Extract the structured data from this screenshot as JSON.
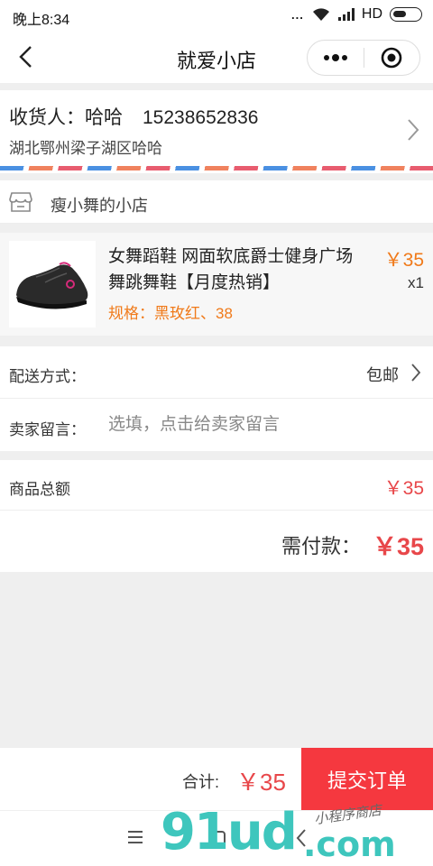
{
  "status_bar": {
    "time": "晚上8:34",
    "dots": "...",
    "network": "HD"
  },
  "nav": {
    "title": "就爱小店",
    "icons": [
      "back-arrow-icon",
      "more-dots-icon",
      "close-circle-icon"
    ]
  },
  "address": {
    "recipient": "收货人：哈哈",
    "phone": "15238652836",
    "detail": "湖北鄂州梁子湖区哈哈"
  },
  "store": {
    "name": "瘦小舞的小店",
    "icon": "store-icon"
  },
  "product": {
    "title": "女舞蹈鞋 网面软底爵士健身广场舞跳舞鞋【月度热销】",
    "spec": "规格：黑玫红、38",
    "price": "￥35",
    "quantity": "x1"
  },
  "delivery": {
    "label": "配送方式：",
    "value": "包邮"
  },
  "message": {
    "label": "卖家留言：",
    "placeholder": "选填，点击给卖家留言",
    "value": ""
  },
  "summary": {
    "goods_total_label": "商品总额",
    "goods_total_value": "￥35",
    "payable_label": "需付款：",
    "payable_value": "￥35"
  },
  "bottom_bar": {
    "total_label": "合计:",
    "total_value": "￥35",
    "submit_label": "提交订单"
  },
  "watermark": {
    "brand": "91ud",
    "domain": ".com",
    "tagline": "小程序商店"
  },
  "colors": {
    "accent_red": "#f5383f",
    "price_orange": "#f07a1a",
    "price_red": "#e8474a",
    "watermark_teal": "#3ec6bd"
  }
}
